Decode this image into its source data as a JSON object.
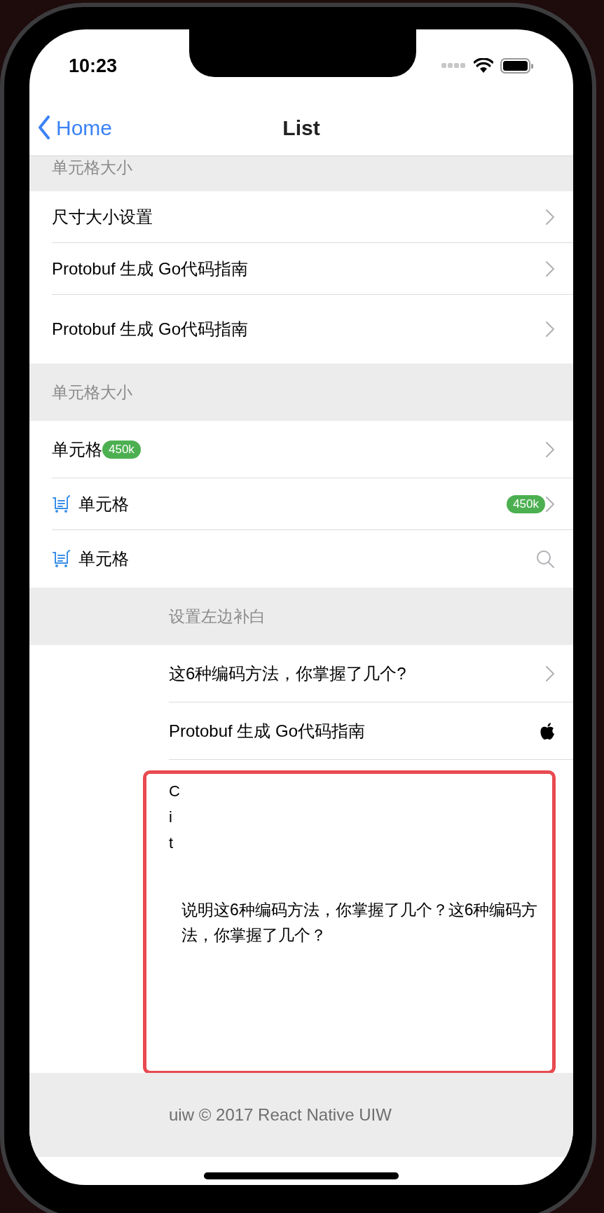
{
  "status_bar": {
    "time": "10:23"
  },
  "nav": {
    "back": "Home",
    "title": "List"
  },
  "sections": [
    {
      "header": "单元格大小",
      "rows": [
        {
          "kind": "link",
          "label": "尺寸大小设置"
        },
        {
          "kind": "link",
          "label": "Protobuf 生成 Go代码指南"
        },
        {
          "kind": "link",
          "label": "Protobuf 生成 Go代码指南"
        }
      ]
    },
    {
      "header": "单元格大小",
      "rows": [
        {
          "kind": "link",
          "label": "单元格",
          "inline_badge": "450k"
        },
        {
          "kind": "iconlink",
          "label": "单元格",
          "badge": "450k"
        },
        {
          "kind": "iconsearch",
          "label": "单元格"
        }
      ]
    },
    {
      "header": "设置左边补白",
      "rows": [
        {
          "kind": "link",
          "label": "这6种编码方法，你掌握了几个?"
        },
        {
          "kind": "apple",
          "label": "Protobuf 生成 Go代码指南"
        },
        {
          "kind": "custom",
          "vertical_text": "Cit",
          "text": "说明这6种编码方法，你掌握了几个？这6种编码方法，你掌握了几个？"
        }
      ]
    }
  ],
  "footer": "uiw © 2017 React Native UIW"
}
